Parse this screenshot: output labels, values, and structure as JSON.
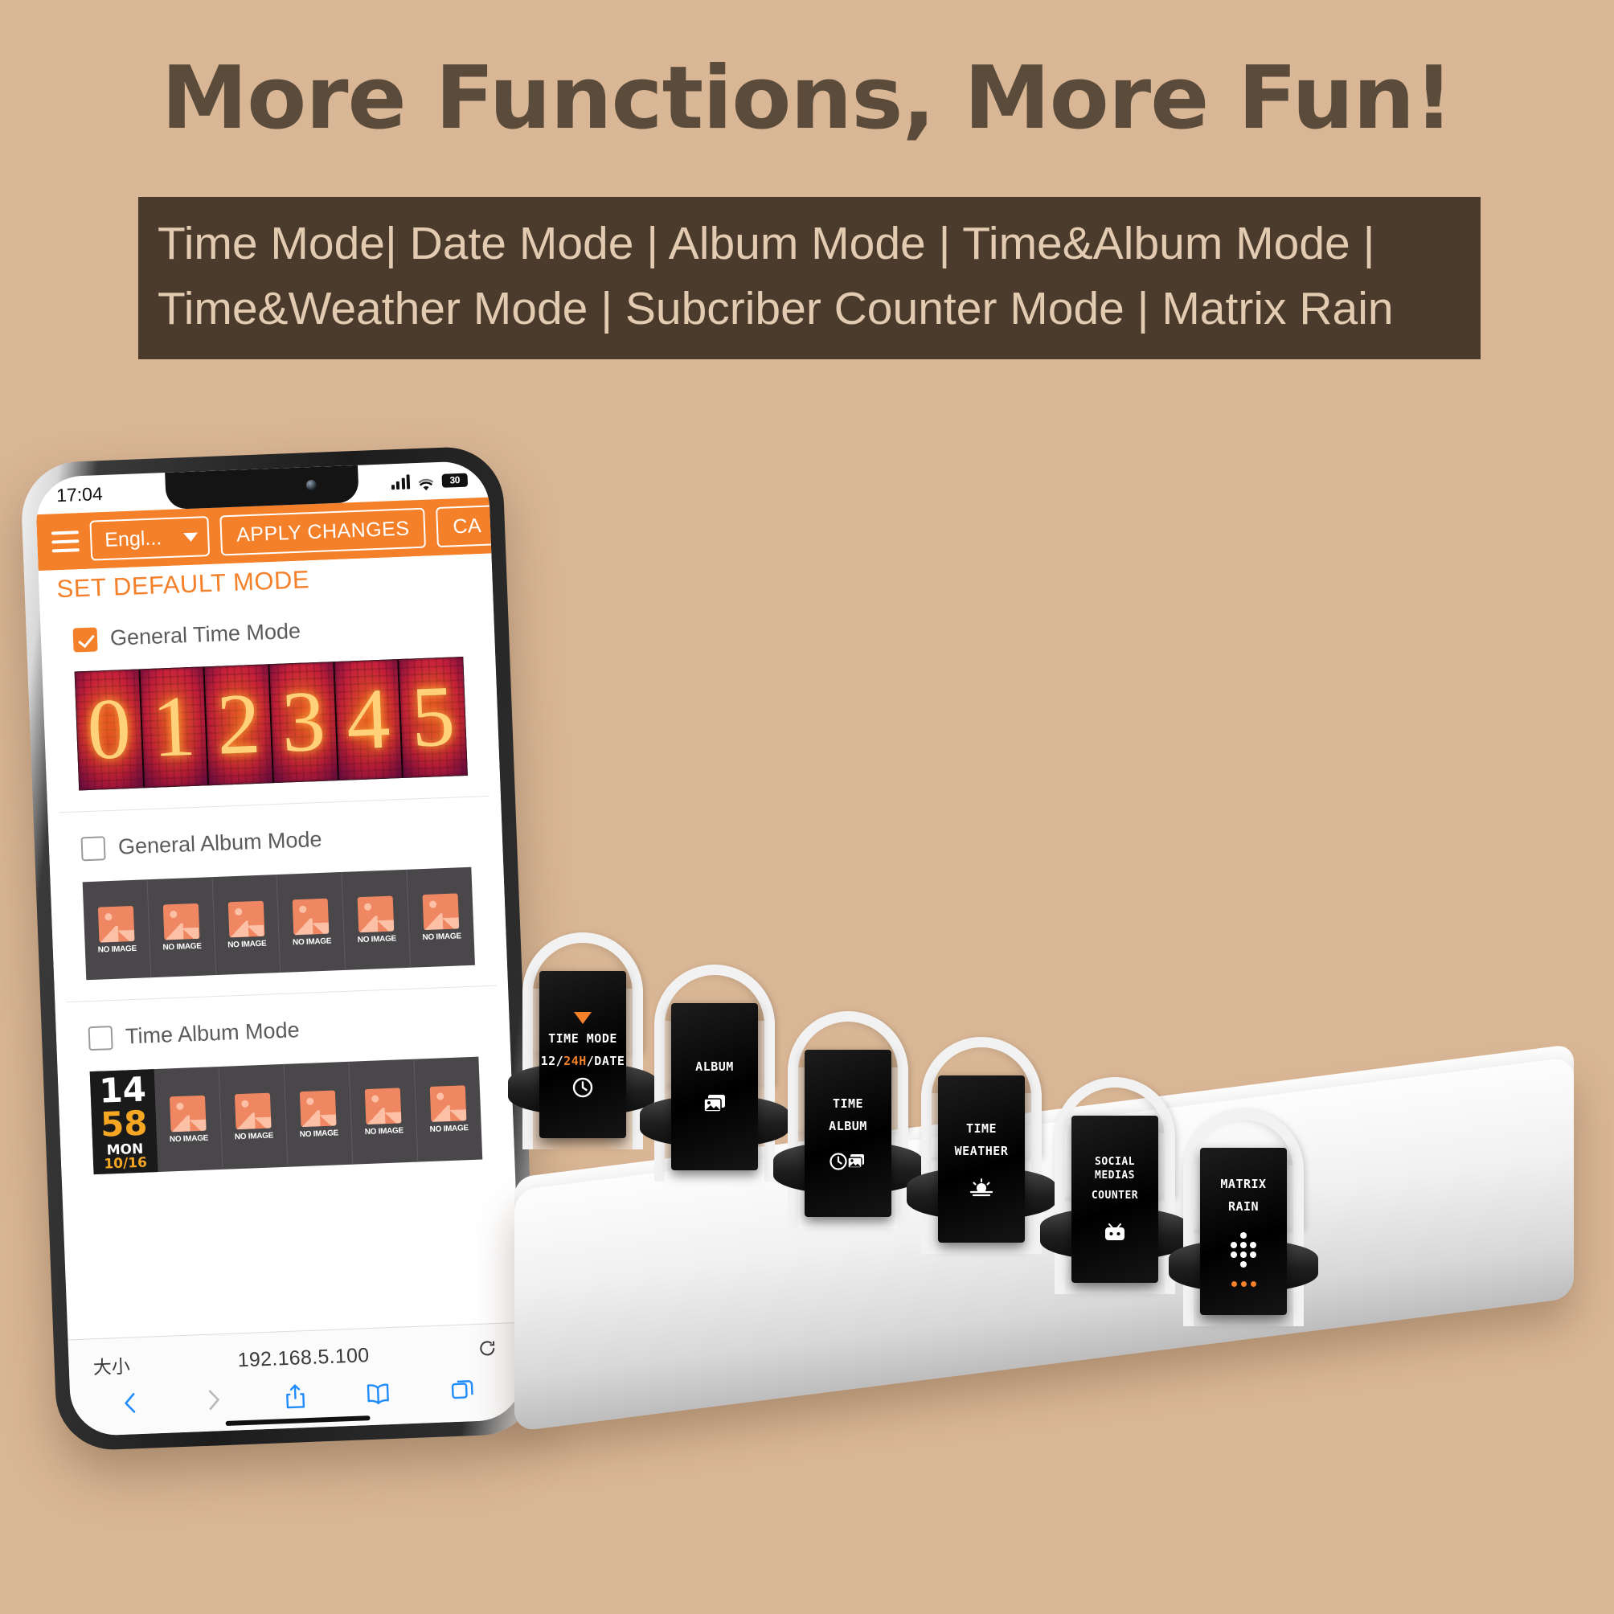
{
  "header": {
    "headline": "More Functions, More Fun!",
    "mode_line_1": "Time Mode| Date Mode | Album Mode | Time&Album Mode |",
    "mode_line_2": "Time&Weather Mode | Subcriber Counter Mode | Matrix Rain",
    "bg_color": "#d9b695",
    "headline_color": "#5b4b3a",
    "bar_color": "#4a3b2d",
    "bar_text_color": "#e2cbb0"
  },
  "phone": {
    "status": {
      "time": "17:04",
      "signal_icon": "cellular-signal-icon",
      "wifi_icon": "wifi-icon",
      "battery_label": "30",
      "battery_icon": "battery-icon"
    },
    "app": {
      "accent_color": "#f4802a",
      "menu_icon": "hamburger-menu-icon",
      "language": "Engl...",
      "apply_label": "APPLY CHANGES",
      "cancel_label": "CA",
      "section_title": "SET DEFAULT MODE",
      "modes": [
        {
          "label": "General Time Mode",
          "checked": true,
          "preview": "nixie-digits",
          "digits": [
            "0",
            "1",
            "2",
            "3",
            "4",
            "5"
          ]
        },
        {
          "label": "General Album Mode",
          "checked": false,
          "preview": "album-placeholders",
          "placeholder_label": "NO IMAGE",
          "cells": 6
        },
        {
          "label": "Time Album Mode",
          "checked": false,
          "preview": "time-album",
          "placeholder_label": "NO IMAGE",
          "cells": 5,
          "clock": {
            "hour": "14",
            "minute": "58",
            "weekday": "MON",
            "date": "10/16"
          }
        }
      ]
    },
    "safari": {
      "text_size_label": "大小",
      "url": "192.168.5.100",
      "reload_icon": "reload-icon",
      "back_icon": "chevron-left-icon",
      "forward_icon": "chevron-right-icon",
      "share_icon": "share-icon",
      "bookmarks_icon": "book-icon",
      "tabs_icon": "tabs-icon"
    }
  },
  "device": {
    "tubes": [
      {
        "line1": "TIME MODE",
        "line2_a": "12/",
        "line2_b": "24H",
        "line2_c": "/DATE",
        "icon": "clock-icon",
        "top_icon": "triangle-down-icon"
      },
      {
        "line1": "ALBUM",
        "line2_a": "",
        "line2_b": "",
        "line2_c": "",
        "icon": "photos-stack-icon",
        "top_icon": ""
      },
      {
        "line1": "TIME",
        "line2_a": "ALBUM",
        "line2_b": "",
        "line2_c": "",
        "icon": "clock-photo-icon",
        "top_icon": ""
      },
      {
        "line1": "TIME",
        "line2_a": "WEATHER",
        "line2_b": "",
        "line2_c": "",
        "icon": "sunrise-icon",
        "top_icon": ""
      },
      {
        "line1": "SOCIAL MEDIAS",
        "line2_a": "COUNTER",
        "line2_b": "",
        "line2_c": "",
        "icon": "bilibili-tv-icon",
        "top_icon": ""
      },
      {
        "line1": "MATRIX",
        "line2_a": "RAIN",
        "line2_b": "",
        "line2_c": "",
        "icon": "dot-matrix-icon",
        "top_icon": ""
      }
    ]
  }
}
